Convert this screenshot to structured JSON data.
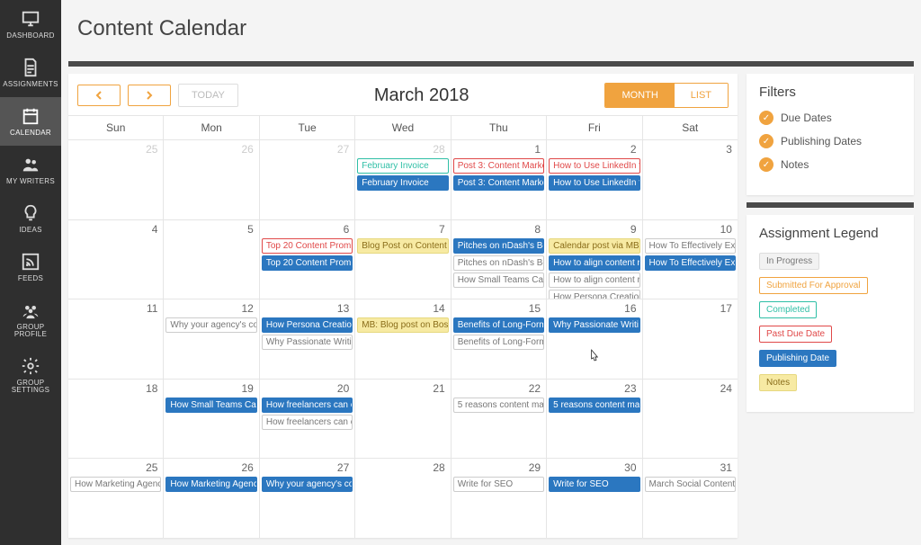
{
  "sidebar": {
    "items": [
      {
        "label": "DASHBOARD"
      },
      {
        "label": "ASSIGNMENTS"
      },
      {
        "label": "CALENDAR"
      },
      {
        "label": "MY WRITERS"
      },
      {
        "label": "IDEAS"
      },
      {
        "label": "FEEDS"
      },
      {
        "label": "GROUP PROFILE"
      },
      {
        "label": "GROUP SETTINGS"
      }
    ]
  },
  "header": {
    "title": "Content Calendar"
  },
  "toolbar": {
    "today": "TODAY",
    "title": "March 2018",
    "month": "MONTH",
    "list": "LIST"
  },
  "dow": [
    "Sun",
    "Mon",
    "Tue",
    "Wed",
    "Thu",
    "Fri",
    "Sat"
  ],
  "weeks": [
    [
      {
        "n": "25",
        "other": true,
        "events": []
      },
      {
        "n": "26",
        "other": true,
        "events": []
      },
      {
        "n": "27",
        "other": true,
        "events": []
      },
      {
        "n": "28",
        "other": true,
        "events": [
          {
            "t": "February Invoice",
            "c": "completed"
          },
          {
            "t": "February Invoice",
            "c": "publish"
          }
        ]
      },
      {
        "n": "1",
        "events": [
          {
            "t": "Post 3: Content Marke",
            "c": "pastdue"
          },
          {
            "t": "Post 3: Content Marke",
            "c": "publish"
          }
        ]
      },
      {
        "n": "2",
        "events": [
          {
            "t": "How to Use LinkedIn f",
            "c": "pastdue"
          },
          {
            "t": "How to Use LinkedIn f",
            "c": "publish"
          }
        ]
      },
      {
        "n": "3",
        "events": []
      }
    ],
    [
      {
        "n": "4",
        "events": []
      },
      {
        "n": "5",
        "events": []
      },
      {
        "n": "6",
        "events": [
          {
            "t": "Top 20 Content Prom",
            "c": "pastdue"
          },
          {
            "t": "Top 20 Content Prom",
            "c": "publish"
          }
        ]
      },
      {
        "n": "7",
        "events": [
          {
            "t": "Blog Post on Content",
            "c": "note"
          }
        ]
      },
      {
        "n": "8",
        "events": [
          {
            "t": "Pitches on nDash's Be",
            "c": "publish"
          },
          {
            "t": "Pitches on nDash's Be",
            "c": "progress"
          },
          {
            "t": "How Small Teams Can",
            "c": "progress"
          }
        ]
      },
      {
        "n": "9",
        "events": [
          {
            "t": "Calendar post via MB",
            "c": "note"
          },
          {
            "t": "How to align content r",
            "c": "publish"
          },
          {
            "t": "How to align content r",
            "c": "progress"
          },
          {
            "t": "How Persona Creation",
            "c": "progress"
          }
        ]
      },
      {
        "n": "10",
        "events": [
          {
            "t": "How To Effectively Ex",
            "c": "progress"
          },
          {
            "t": "How To Effectively Ex",
            "c": "publish"
          }
        ]
      }
    ],
    [
      {
        "n": "11",
        "events": []
      },
      {
        "n": "12",
        "events": [
          {
            "t": "Why your agency's co",
            "c": "progress"
          }
        ]
      },
      {
        "n": "13",
        "events": [
          {
            "t": "How Persona Creation",
            "c": "publish"
          },
          {
            "t": "Why Passionate Writi",
            "c": "progress"
          }
        ]
      },
      {
        "n": "14",
        "events": [
          {
            "t": "MB: Blog post on Bost",
            "c": "note"
          }
        ]
      },
      {
        "n": "15",
        "events": [
          {
            "t": "Benefits of Long-Form",
            "c": "publish"
          },
          {
            "t": "Benefits of Long-Form",
            "c": "progress"
          }
        ]
      },
      {
        "n": "16",
        "events": [
          {
            "t": "Why Passionate Writi",
            "c": "publish"
          }
        ]
      },
      {
        "n": "17",
        "events": []
      }
    ],
    [
      {
        "n": "18",
        "events": []
      },
      {
        "n": "19",
        "events": [
          {
            "t": "How Small Teams Can",
            "c": "publish"
          }
        ]
      },
      {
        "n": "20",
        "events": [
          {
            "t": "How freelancers can e",
            "c": "publish"
          },
          {
            "t": "How freelancers can e",
            "c": "progress"
          }
        ]
      },
      {
        "n": "21",
        "events": []
      },
      {
        "n": "22",
        "events": [
          {
            "t": "5 reasons content ma",
            "c": "progress"
          }
        ]
      },
      {
        "n": "23",
        "events": [
          {
            "t": "5 reasons content ma",
            "c": "publish"
          }
        ]
      },
      {
        "n": "24",
        "events": []
      }
    ],
    [
      {
        "n": "25",
        "events": [
          {
            "t": "How Marketing Agenc",
            "c": "progress"
          }
        ]
      },
      {
        "n": "26",
        "events": [
          {
            "t": "How Marketing Agenc",
            "c": "publish"
          }
        ]
      },
      {
        "n": "27",
        "events": [
          {
            "t": "Why your agency's co",
            "c": "publish"
          }
        ]
      },
      {
        "n": "28",
        "events": []
      },
      {
        "n": "29",
        "events": [
          {
            "t": "Write for SEO",
            "c": "progress"
          }
        ]
      },
      {
        "n": "30",
        "events": [
          {
            "t": "Write for SEO",
            "c": "publish"
          }
        ]
      },
      {
        "n": "31",
        "events": [
          {
            "t": "March Social Content",
            "c": "progress"
          }
        ]
      }
    ]
  ],
  "filters": {
    "title": "Filters",
    "items": [
      "Due Dates",
      "Publishing Dates",
      "Notes"
    ]
  },
  "legend": {
    "title": "Assignment Legend",
    "items": [
      {
        "label": "In Progress",
        "c": "lg-progress"
      },
      {
        "label": "Submitted For Approval",
        "c": "lg-submitted"
      },
      {
        "label": "Completed",
        "c": "lg-completed"
      },
      {
        "label": "Past Due Date",
        "c": "lg-pastdue"
      },
      {
        "label": "Publishing Date",
        "c": "lg-publish"
      },
      {
        "label": "Notes",
        "c": "lg-notes"
      }
    ]
  }
}
